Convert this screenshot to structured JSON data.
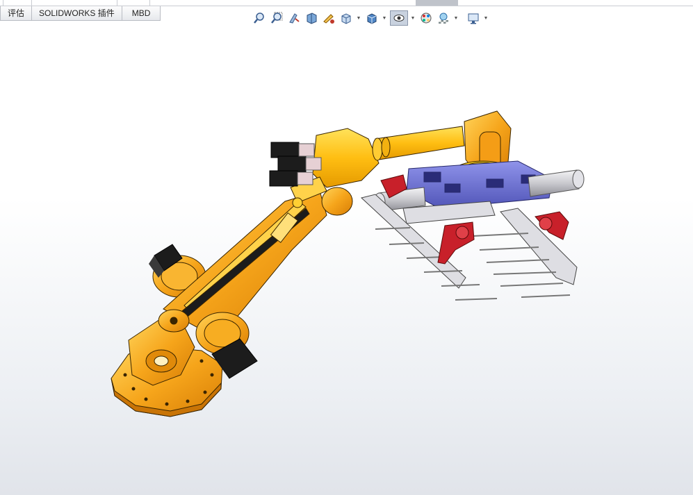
{
  "tabs": [
    "评估",
    "SOLIDWORKS 插件",
    "MBD"
  ],
  "toolbar": {
    "icons": [
      "zoom-to-fit-icon",
      "zoom-area-icon",
      "previous-view-icon",
      "section-view-icon",
      "dynamic-annotation-icon",
      "view-orientation-icon",
      "display-style-icon",
      "hide-show-items-icon",
      "edit-appearance-icon",
      "apply-scene-icon",
      "view-settings-icon"
    ]
  },
  "colors": {
    "robot_orange": "#f5a623",
    "robot_yellow": "#ffc20e",
    "motor_black": "#1c1c1c",
    "gripper_blue": "#6f73d8",
    "gripper_red": "#c8202a",
    "gripper_gray": "#d9d9de"
  }
}
